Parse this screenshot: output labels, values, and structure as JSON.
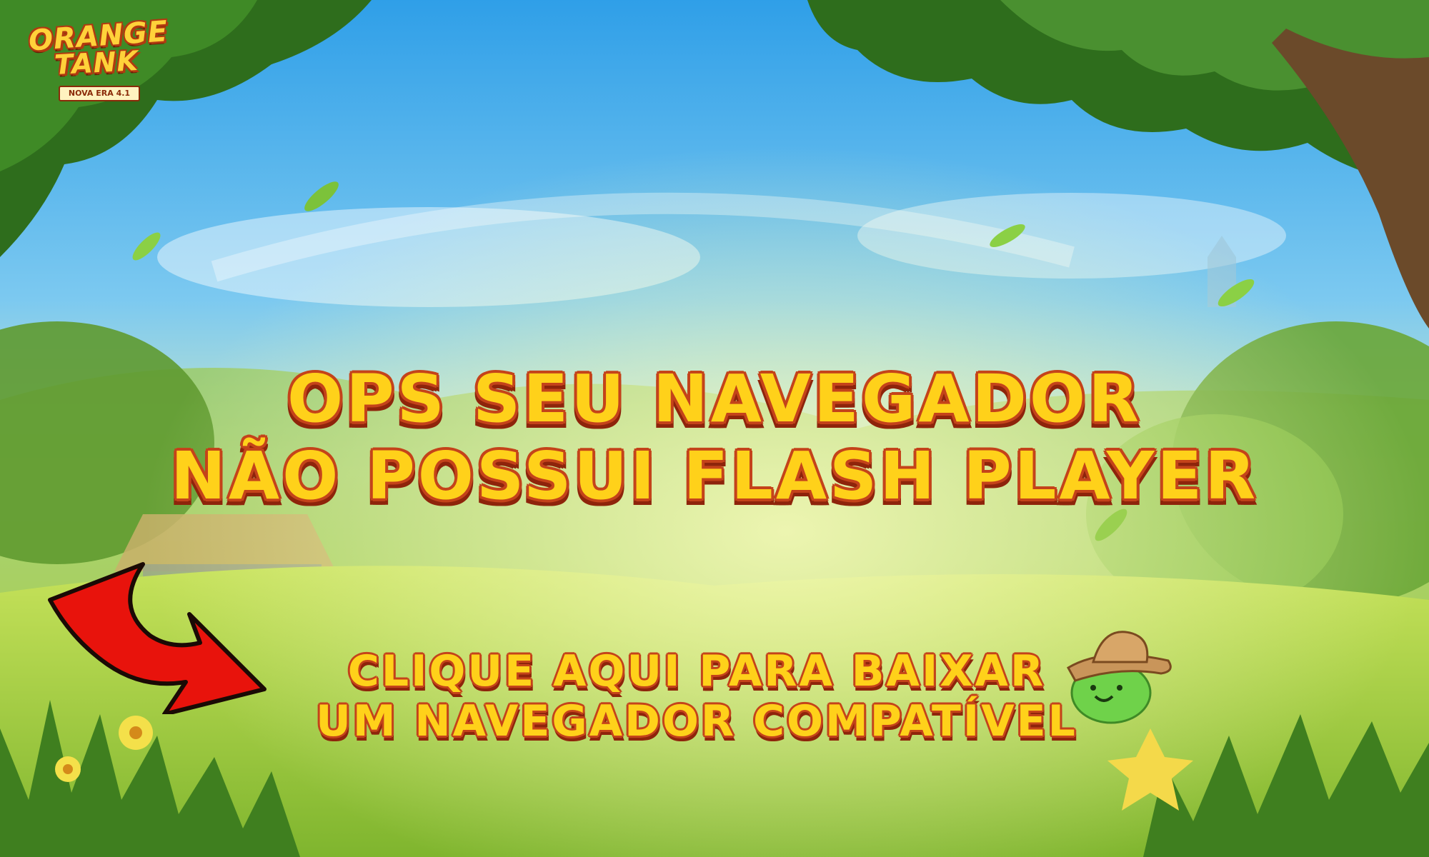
{
  "logo": {
    "word1": "ORANGE",
    "word2": "TANK",
    "subtitle": "NOVA ERA 4.1"
  },
  "headline": {
    "line1": "OPS SEU NAVEGADOR",
    "line2": "NÃO POSSUI FLASH PLAYER"
  },
  "cta": {
    "line1": "CLIQUE AQUI PARA BAIXAR",
    "line2": "UM NAVEGADOR COMPATÍVEL"
  },
  "icons": {
    "arrow": "red-curved-arrow-icon",
    "mascot": "green-slime-cowboy-hat-icon"
  },
  "colors": {
    "title_fill": "#ffd11a",
    "title_outline": "#c4431a",
    "title_shadow": "#8e240b",
    "arrow": "#e8130c"
  }
}
